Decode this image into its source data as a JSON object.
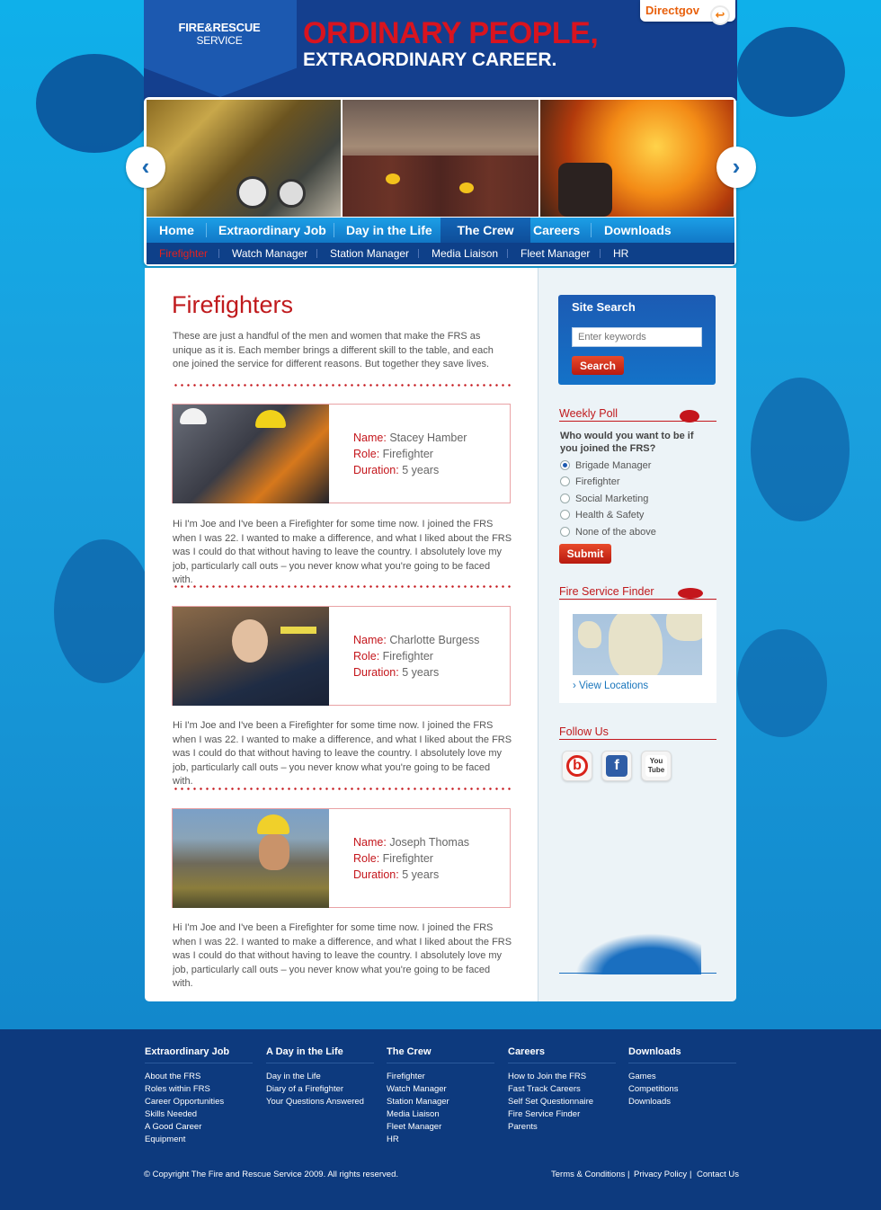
{
  "header": {
    "logo_line1": "FIRE&RESCUE",
    "logo_line2": "SERVICE",
    "headline1": "ORDINARY PEOPLE,",
    "headline2": "EXTRAORDINARY CAREER.",
    "directgov_label": "Directgov"
  },
  "nav": {
    "items": [
      "Home",
      "Extraordinary Job",
      "Day in the Life",
      "The Crew",
      "Careers",
      "Downloads"
    ],
    "active": "The Crew"
  },
  "subnav": {
    "items": [
      "Firefighter",
      "Watch Manager",
      "Station Manager",
      "Media Liaison",
      "Fleet Manager",
      "HR"
    ],
    "active": "Firefighter"
  },
  "main": {
    "title": "Firefighters",
    "intro": "These are just a handful of the men and women that make the FRS as unique as it is. Each member brings a different skill to the table, and each one joined the service for different reasons. But together they save lives.",
    "labels": {
      "name": "Name:",
      "role": "Role:",
      "duration": "Duration:"
    },
    "people": [
      {
        "name": "Stacey Hamber",
        "role": "Firefighter",
        "duration": "5 years",
        "bio": "Hi I'm Joe and I've been a Firefighter for some time now. I joined the FRS when I was 22. I wanted to make a difference, and what I liked about the FRS was I could do that without having to leave the country. I absolutely love my job, particularly call outs – you never know what you're going to be faced with."
      },
      {
        "name": "Charlotte Burgess",
        "role": "Firefighter",
        "duration": "5 years",
        "bio": "Hi I'm Joe and I've been a Firefighter for some time now. I joined the FRS when I was 22. I wanted to make a difference, and what I liked about the FRS was I could do that without having to leave the country. I absolutely love my job, particularly call outs – you never know what you're going to be faced with."
      },
      {
        "name": "Joseph Thomas",
        "role": "Firefighter",
        "duration": "5 years",
        "bio": "Hi I'm Joe and I've been a Firefighter for some time now. I joined the FRS when I was 22. I wanted to make a difference, and what I liked about the FRS was I could do that without having to leave the country. I absolutely love my job, particularly call outs – you never know what you're going to be faced with."
      }
    ]
  },
  "sidebar": {
    "search": {
      "title": "Site Search",
      "placeholder": "Enter keywords",
      "button": "Search"
    },
    "poll": {
      "title": "Weekly Poll",
      "question": "Who would you want to be if you joined the FRS?",
      "options": [
        "Brigade Manager",
        "Firefighter",
        "Social Marketing",
        "Health & Safety",
        "None of the above"
      ],
      "selected": "Brigade Manager",
      "submit": "Submit"
    },
    "finder": {
      "title": "Fire Service Finder",
      "link": "› View Locations"
    },
    "follow": {
      "title": "Follow Us",
      "networks": [
        "bebo-icon",
        "facebook-icon",
        "youtube-icon"
      ],
      "youtube_label": "You Tube"
    }
  },
  "footer": {
    "columns": [
      {
        "heading": "Extraordinary Job",
        "items": [
          "About the FRS",
          "Roles within FRS",
          "Career Opportunities",
          "Skills Needed",
          "A Good Career",
          "Equipment"
        ]
      },
      {
        "heading": "A Day in the Life",
        "items": [
          "Day in the Life",
          "Diary of a Firefighter",
          "Your Questions Answered"
        ]
      },
      {
        "heading": "The Crew",
        "items": [
          "Firefighter",
          "Watch Manager",
          "Station Manager",
          "Media Liaison",
          "Fleet Manager",
          "HR"
        ]
      },
      {
        "heading": "Careers",
        "items": [
          "How to Join the FRS",
          "Fast Track Careers",
          "Self Set Questionnaire",
          "Fire Service Finder",
          "Parents"
        ]
      },
      {
        "heading": "Downloads",
        "items": [
          "Games",
          "Competitions",
          "Downloads"
        ]
      }
    ],
    "copyright": "© Copyright The Fire and Rescue Service 2009. All rights reserved.",
    "links": [
      "Terms & Conditions",
      "Privacy Policy",
      "Contact Us"
    ]
  },
  "colors": {
    "brand_red": "#c4161c",
    "brand_blue": "#143f8e",
    "sky_blue": "#1596d6"
  }
}
